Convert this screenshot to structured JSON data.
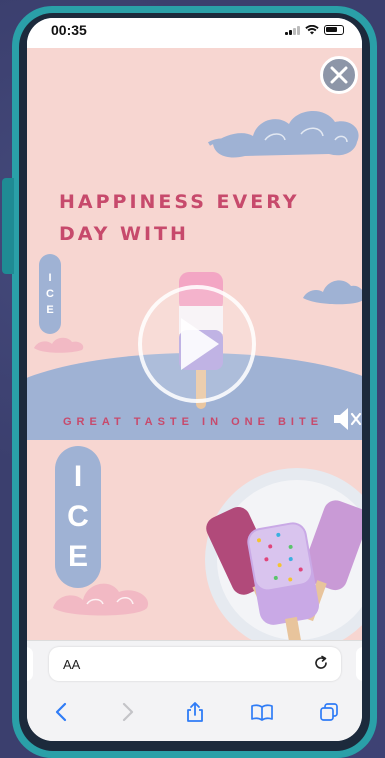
{
  "status_bar": {
    "time": "00:35"
  },
  "ad": {
    "headline_line1": "HAPPINESS EVERY",
    "headline_line2": "DAY WITH",
    "tagline": "GREAT TASTE IN ONE BITE",
    "ice_tag_small": [
      "I",
      "C",
      "E"
    ],
    "ice_tag_big": [
      "I",
      "C",
      "E"
    ]
  },
  "browser": {
    "text_size_label": "AA"
  },
  "icons": {
    "close": "close-icon",
    "play": "play-icon",
    "mute": "speaker-muted-icon",
    "reload": "reload-icon",
    "back": "chevron-left-icon",
    "forward": "chevron-right-icon",
    "share": "share-icon",
    "bookmarks": "book-icon",
    "tabs": "tabs-icon"
  },
  "colors": {
    "frame": "#2aa0a8",
    "ad_background": "#f7d6d1",
    "accent_text": "#c74a6c",
    "cloud": "#9fb2d4",
    "ios_blue": "#2f7cf6"
  }
}
